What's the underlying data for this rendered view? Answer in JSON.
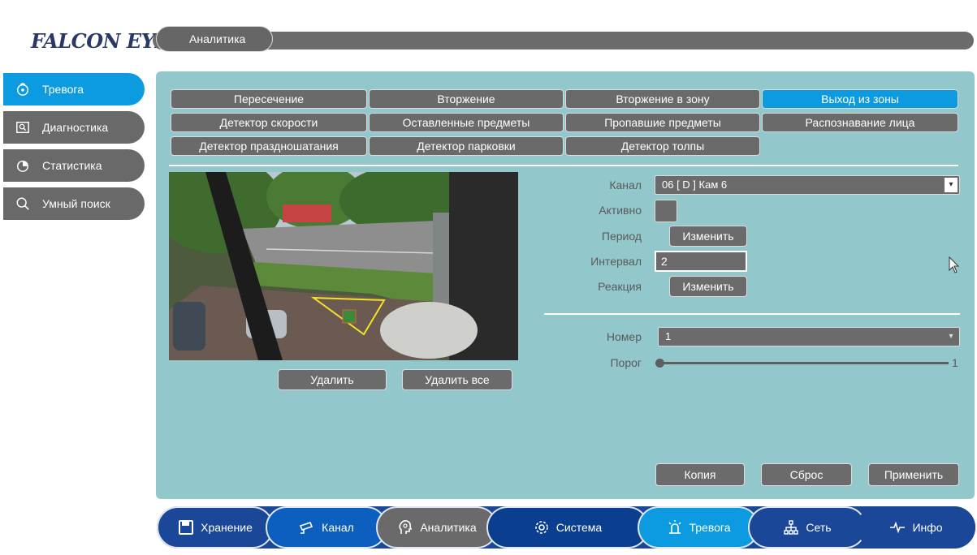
{
  "brand": {
    "logo_text": "FALCON EYE"
  },
  "header": {
    "title": "Аналитика"
  },
  "sidebar": {
    "items": [
      {
        "label": "Тревога",
        "icon": "alarm-icon",
        "active": true
      },
      {
        "label": "Диагностика",
        "icon": "diagnostics-icon",
        "active": false
      },
      {
        "label": "Статистика",
        "icon": "pie-chart-icon",
        "active": false
      },
      {
        "label": "Умный поиск",
        "icon": "search-icon",
        "active": false
      }
    ]
  },
  "tabs": {
    "row1": [
      "Пересечение",
      "Вторжение",
      "Вторжение в зону",
      "Выход из зоны"
    ],
    "row2": [
      "Детектор скорости",
      "Оставленные предметы",
      "Пропавшие предметы",
      "Распознавание лица"
    ],
    "row3": [
      "Детектор праздношатания",
      "Детектор парковки",
      "Детектор толпы"
    ],
    "active": "Выход из зоны"
  },
  "preview": {
    "delete_label": "Удалить",
    "delete_all_label": "Удалить все"
  },
  "settings": {
    "channel_label": "Канал",
    "channel_value": "06 [ D ] Кам 6",
    "active_label": "Активно",
    "period_label": "Период",
    "period_button": "Изменить",
    "interval_label": "Интервал",
    "interval_value": "2",
    "reaction_label": "Реакция",
    "reaction_button": "Изменить",
    "number_label": "Номер",
    "number_value": "1",
    "threshold_label": "Порог",
    "threshold_value": "1"
  },
  "actions": {
    "copy_label": "Копия",
    "reset_label": "Сброс",
    "apply_label": "Применить"
  },
  "navbar": {
    "items": [
      {
        "label": "Хранение",
        "icon": "save-icon"
      },
      {
        "label": "Канал",
        "icon": "camera-icon"
      },
      {
        "label": "Аналитика",
        "icon": "analytics-head-icon"
      },
      {
        "label": "Система",
        "icon": "gear-icon"
      },
      {
        "label": "Тревога",
        "icon": "alarm-icon"
      },
      {
        "label": "Сеть",
        "icon": "network-icon"
      },
      {
        "label": "Инфо",
        "icon": "pulse-icon"
      }
    ]
  },
  "colors": {
    "accent": "#0c9be0",
    "panel": "#92c8cb",
    "control": "#6b6b6b",
    "nav": "#1a4797"
  }
}
